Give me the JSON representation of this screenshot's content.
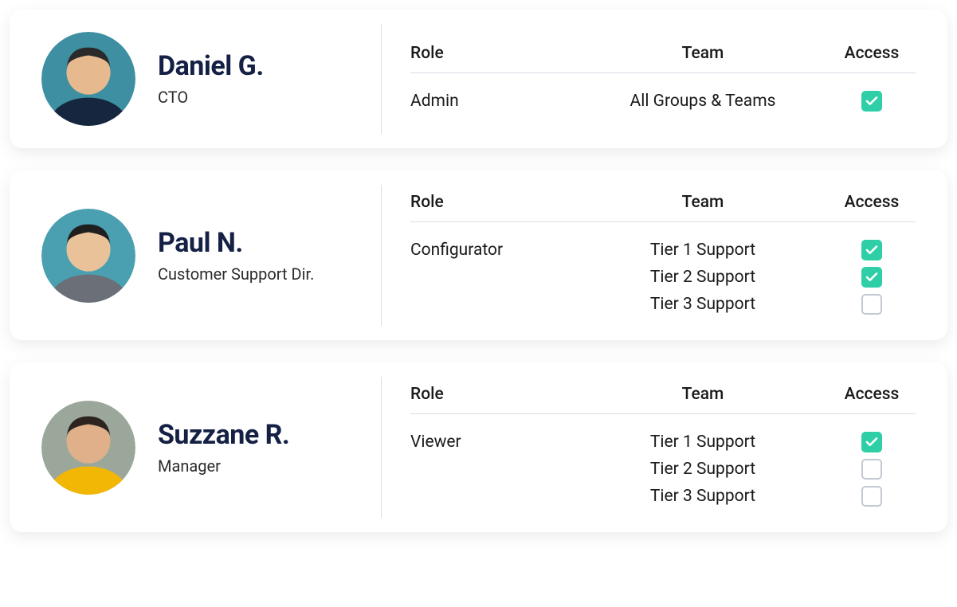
{
  "headers": {
    "role": "Role",
    "team": "Team",
    "access": "Access"
  },
  "colors": {
    "accent": "#2ecfa6",
    "heading": "#142044"
  },
  "users": [
    {
      "name": "Daniel G.",
      "title": "CTO",
      "avatar_bg": "#3e8fa1",
      "role": "Admin",
      "rows": [
        {
          "team": "All Groups & Teams",
          "access": true
        }
      ]
    },
    {
      "name": "Paul N.",
      "title": "Customer Support Dir.",
      "avatar_bg": "#4aa0b0",
      "role": "Configurator",
      "rows": [
        {
          "team": "Tier 1 Support",
          "access": true
        },
        {
          "team": "Tier 2 Support",
          "access": true
        },
        {
          "team": "Tier 3 Support",
          "access": false
        }
      ]
    },
    {
      "name": "Suzzane R.",
      "title": "Manager",
      "avatar_bg": "#9aa79a",
      "role": "Viewer",
      "rows": [
        {
          "team": "Tier 1 Support",
          "access": true
        },
        {
          "team": "Tier 2 Support",
          "access": false
        },
        {
          "team": "Tier 3 Support",
          "access": false
        }
      ]
    }
  ]
}
